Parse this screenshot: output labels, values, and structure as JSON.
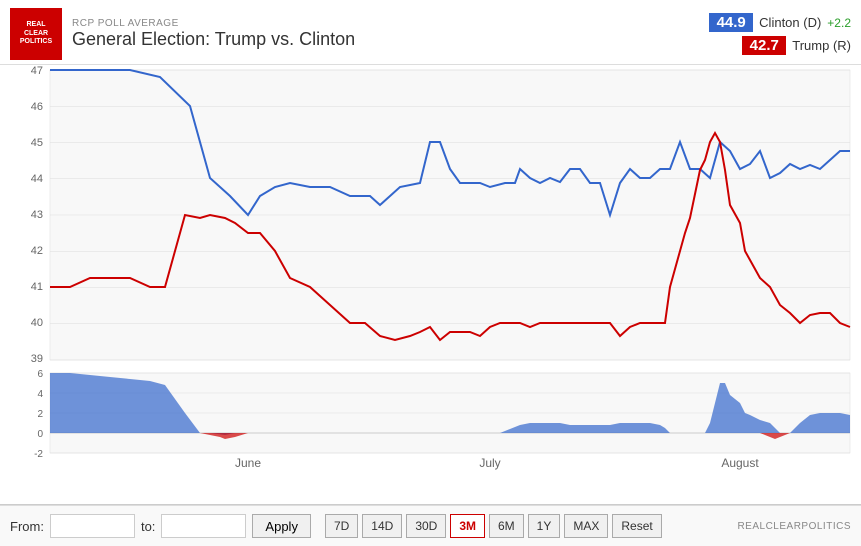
{
  "header": {
    "rcp_label": "RCP POLL AVERAGE",
    "chart_title": "General Election: Trump vs. Clinton",
    "logo_line1": "REAL",
    "logo_line2": "CLEAR",
    "logo_line3": "POLITICS"
  },
  "legend": {
    "clinton_value": "44.9",
    "clinton_label": "Clinton (D)",
    "clinton_change": "+2.2",
    "trump_value": "42.7",
    "trump_label": "Trump (R)"
  },
  "footer": {
    "from_label": "From:",
    "to_label": "to:",
    "apply_label": "Apply",
    "from_value": "",
    "to_value": "",
    "range_buttons": [
      "7D",
      "14D",
      "30D",
      "3M",
      "6M",
      "1Y",
      "MAX",
      "Reset"
    ],
    "active_range": "3M",
    "brand": "REALCLEARPOLITICS"
  },
  "chart": {
    "y_axis_main": [
      47,
      46,
      45,
      44,
      43,
      42,
      41,
      40,
      39
    ],
    "y_axis_spread": [
      6,
      4,
      2,
      0,
      -2
    ],
    "x_axis_labels": [
      "June",
      "July",
      "August"
    ]
  }
}
